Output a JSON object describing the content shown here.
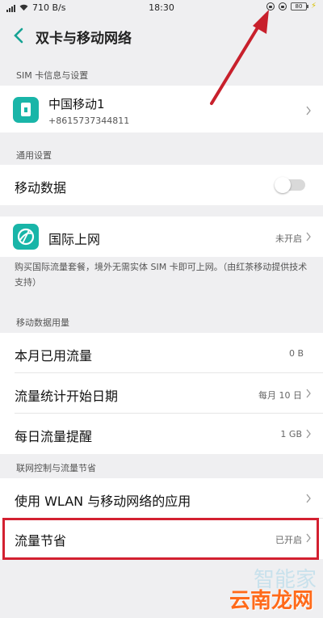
{
  "status_bar": {
    "net_speed": "710 B/s",
    "time": "18:30",
    "battery": "80"
  },
  "header": {
    "title": "双卡与移动网络"
  },
  "sections": {
    "sim": "SIM 卡信息与设置",
    "general": "通用设置",
    "usage": "移动数据用量",
    "control": "联网控制与流量节省"
  },
  "sim_card": {
    "name": "中国移动1",
    "number": "+8615737344811"
  },
  "mobile_data": {
    "label": "移动数据",
    "enabled": false
  },
  "intl": {
    "label": "国际上网",
    "status": "未开启",
    "note": "购买国际流量套餐，境外无需实体 SIM 卡即可上网。（由红茶移动提供技术支持）"
  },
  "usage_rows": [
    {
      "label": "本月已用流量",
      "value": "0 B"
    },
    {
      "label": "流量统计开始日期",
      "value": "每月 10 日"
    },
    {
      "label": "每日流量提醒",
      "value": "1 GB"
    }
  ],
  "control_rows": [
    {
      "label": "使用 WLAN 与移动网络的应用",
      "value": ""
    },
    {
      "label": "流量节省",
      "value": "已开启"
    }
  ],
  "watermark": {
    "top": "智能家",
    "bottom": "云南龙网"
  },
  "colors": {
    "accent": "#19b5a8",
    "highlight": "#d32030",
    "arrow": "#c8202c"
  }
}
